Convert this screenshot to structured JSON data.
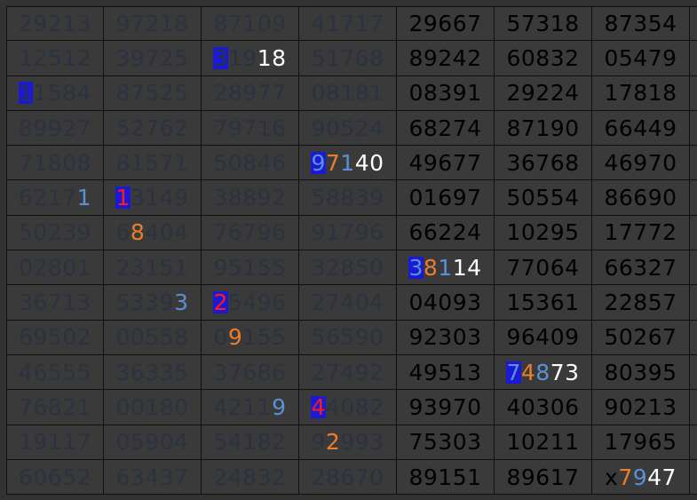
{
  "colors": {
    "background": "#333333",
    "grid_line": "#101010",
    "faded_digit": "#2b3240",
    "bright_digit": "#000000",
    "highlight_box": "#1a1ad6",
    "blue": "#5b8fd6",
    "red": "#ff1a1a",
    "orange": "#ea7d2e",
    "white": "#ffffff"
  },
  "rows": [
    [
      {
        "style": "faded",
        "text": "29213"
      },
      {
        "style": "faded",
        "text": "97218"
      },
      {
        "style": "faded",
        "text": "87109"
      },
      {
        "style": "faded",
        "text": "41717"
      },
      {
        "style": "bright",
        "text": "29667"
      },
      {
        "style": "bright",
        "text": "57318"
      },
      {
        "style": "bright",
        "text": "87354"
      }
    ],
    [
      {
        "style": "faded",
        "text": "12512"
      },
      {
        "style": "faded",
        "text": "39725"
      },
      {
        "style": "mixed",
        "chars": [
          {
            "t": "3",
            "c": "faded",
            "box": true
          },
          {
            "t": "1",
            "c": "faded"
          },
          {
            "t": "9",
            "c": "faded"
          },
          {
            "t": "1",
            "c": "white"
          },
          {
            "t": "8",
            "c": "white"
          }
        ]
      },
      {
        "style": "faded",
        "text": "51768"
      },
      {
        "style": "bright",
        "text": "89242"
      },
      {
        "style": "bright",
        "text": "60832"
      },
      {
        "style": "bright",
        "text": "05479"
      }
    ],
    [
      {
        "style": "mixed",
        "chars": [
          {
            "t": "1",
            "c": "faded",
            "box": true
          },
          {
            "t": "1",
            "c": "faded"
          },
          {
            "t": "5",
            "c": "faded"
          },
          {
            "t": "8",
            "c": "faded"
          },
          {
            "t": "4",
            "c": "faded"
          }
        ]
      },
      {
        "style": "faded",
        "text": "87525"
      },
      {
        "style": "faded",
        "text": "28977"
      },
      {
        "style": "faded",
        "text": "08181"
      },
      {
        "style": "bright",
        "text": "08391"
      },
      {
        "style": "bright",
        "text": "29224"
      },
      {
        "style": "bright",
        "text": "17818"
      }
    ],
    [
      {
        "style": "faded",
        "text": "89927"
      },
      {
        "style": "faded",
        "text": "52762"
      },
      {
        "style": "faded",
        "text": "79716"
      },
      {
        "style": "faded",
        "text": "90524"
      },
      {
        "style": "bright",
        "text": "68274"
      },
      {
        "style": "bright",
        "text": "87190"
      },
      {
        "style": "bright",
        "text": "66449"
      }
    ],
    [
      {
        "style": "faded",
        "text": "71808"
      },
      {
        "style": "faded",
        "text": "81571"
      },
      {
        "style": "faded",
        "text": "50846"
      },
      {
        "style": "mixed",
        "chars": [
          {
            "t": "9",
            "c": "blue",
            "box": true
          },
          {
            "t": "7",
            "c": "orange"
          },
          {
            "t": "1",
            "c": "blue"
          },
          {
            "t": "4",
            "c": "white"
          },
          {
            "t": "0",
            "c": "white"
          }
        ]
      },
      {
        "style": "bright",
        "text": "49677"
      },
      {
        "style": "bright",
        "text": "36768"
      },
      {
        "style": "bright",
        "text": "46970"
      }
    ],
    [
      {
        "style": "mixed",
        "chars": [
          {
            "t": "6",
            "c": "faded"
          },
          {
            "t": "2",
            "c": "faded"
          },
          {
            "t": "1",
            "c": "faded"
          },
          {
            "t": "7",
            "c": "faded"
          },
          {
            "t": "1",
            "c": "blue"
          }
        ]
      },
      {
        "style": "mixed",
        "chars": [
          {
            "t": "1",
            "c": "red",
            "box": true
          },
          {
            "t": "3",
            "c": "faded"
          },
          {
            "t": "1",
            "c": "faded"
          },
          {
            "t": "4",
            "c": "faded"
          },
          {
            "t": "9",
            "c": "faded"
          }
        ]
      },
      {
        "style": "faded",
        "text": "38892"
      },
      {
        "style": "faded",
        "text": "58839"
      },
      {
        "style": "bright",
        "text": "01697"
      },
      {
        "style": "bright",
        "text": "50554"
      },
      {
        "style": "bright",
        "text": "86690"
      }
    ],
    [
      {
        "style": "faded",
        "text": "50239"
      },
      {
        "style": "mixed",
        "chars": [
          {
            "t": "6",
            "c": "faded"
          },
          {
            "t": "8",
            "c": "orange"
          },
          {
            "t": "4",
            "c": "faded"
          },
          {
            "t": "0",
            "c": "faded"
          },
          {
            "t": "4",
            "c": "faded"
          }
        ]
      },
      {
        "style": "faded",
        "text": "76796"
      },
      {
        "style": "faded",
        "text": "91796"
      },
      {
        "style": "bright",
        "text": "66224"
      },
      {
        "style": "bright",
        "text": "10295"
      },
      {
        "style": "bright",
        "text": "17772"
      }
    ],
    [
      {
        "style": "faded",
        "text": "02801"
      },
      {
        "style": "faded",
        "text": "23151"
      },
      {
        "style": "faded",
        "text": "95155"
      },
      {
        "style": "faded",
        "text": "32850"
      },
      {
        "style": "mixed",
        "chars": [
          {
            "t": "3",
            "c": "blue",
            "box": true
          },
          {
            "t": "8",
            "c": "orange"
          },
          {
            "t": "1",
            "c": "blue"
          },
          {
            "t": "1",
            "c": "white"
          },
          {
            "t": "4",
            "c": "white"
          }
        ]
      },
      {
        "style": "bright",
        "text": "77064"
      },
      {
        "style": "bright",
        "text": "66327"
      }
    ],
    [
      {
        "style": "faded",
        "text": "36713"
      },
      {
        "style": "mixed",
        "chars": [
          {
            "t": "5",
            "c": "faded"
          },
          {
            "t": "3",
            "c": "faded"
          },
          {
            "t": "3",
            "c": "faded"
          },
          {
            "t": "9",
            "c": "faded"
          },
          {
            "t": "3",
            "c": "blue"
          }
        ]
      },
      {
        "style": "mixed",
        "chars": [
          {
            "t": "2",
            "c": "red",
            "box": true
          },
          {
            "t": "5",
            "c": "faded"
          },
          {
            "t": "4",
            "c": "faded"
          },
          {
            "t": "9",
            "c": "faded"
          },
          {
            "t": "6",
            "c": "faded"
          }
        ]
      },
      {
        "style": "faded",
        "text": "27404"
      },
      {
        "style": "bright",
        "text": "04093"
      },
      {
        "style": "bright",
        "text": "15361"
      },
      {
        "style": "bright",
        "text": "22857"
      }
    ],
    [
      {
        "style": "faded",
        "text": "69502"
      },
      {
        "style": "faded",
        "text": "00558"
      },
      {
        "style": "mixed",
        "chars": [
          {
            "t": "0",
            "c": "faded"
          },
          {
            "t": "9",
            "c": "orange"
          },
          {
            "t": "1",
            "c": "faded"
          },
          {
            "t": "5",
            "c": "faded"
          },
          {
            "t": "5",
            "c": "faded"
          }
        ]
      },
      {
        "style": "faded",
        "text": "56590"
      },
      {
        "style": "bright",
        "text": "92303"
      },
      {
        "style": "bright",
        "text": "96409"
      },
      {
        "style": "bright",
        "text": "50267"
      }
    ],
    [
      {
        "style": "faded",
        "text": "46555"
      },
      {
        "style": "faded",
        "text": "36335"
      },
      {
        "style": "faded",
        "text": "37686"
      },
      {
        "style": "faded",
        "text": "27492"
      },
      {
        "style": "bright",
        "text": "49513"
      },
      {
        "style": "mixed",
        "chars": [
          {
            "t": "7",
            "c": "blue",
            "box": true
          },
          {
            "t": "4",
            "c": "orange"
          },
          {
            "t": "8",
            "c": "blue"
          },
          {
            "t": "7",
            "c": "white"
          },
          {
            "t": "3",
            "c": "white"
          }
        ]
      },
      {
        "style": "bright",
        "text": "80395"
      }
    ],
    [
      {
        "style": "faded",
        "text": "76821"
      },
      {
        "style": "faded",
        "text": "00180"
      },
      {
        "style": "mixed",
        "chars": [
          {
            "t": "4",
            "c": "faded"
          },
          {
            "t": "2",
            "c": "faded"
          },
          {
            "t": "1",
            "c": "faded"
          },
          {
            "t": "1",
            "c": "faded"
          },
          {
            "t": "9",
            "c": "blue"
          }
        ]
      },
      {
        "style": "mixed",
        "chars": [
          {
            "t": "4",
            "c": "red",
            "box": true
          },
          {
            "t": "4",
            "c": "faded"
          },
          {
            "t": "0",
            "c": "faded"
          },
          {
            "t": "8",
            "c": "faded"
          },
          {
            "t": "2",
            "c": "faded"
          }
        ]
      },
      {
        "style": "bright",
        "text": "93970"
      },
      {
        "style": "bright",
        "text": "40306"
      },
      {
        "style": "bright",
        "text": "90213"
      }
    ],
    [
      {
        "style": "faded",
        "text": "19117"
      },
      {
        "style": "faded",
        "text": "05904"
      },
      {
        "style": "faded",
        "text": "54182"
      },
      {
        "style": "mixed",
        "chars": [
          {
            "t": "9",
            "c": "faded"
          },
          {
            "t": "2",
            "c": "orange"
          },
          {
            "t": "9",
            "c": "faded"
          },
          {
            "t": "9",
            "c": "faded"
          },
          {
            "t": "3",
            "c": "faded"
          }
        ]
      },
      {
        "style": "bright",
        "text": "75303"
      },
      {
        "style": "bright",
        "text": "10211"
      },
      {
        "style": "bright",
        "text": "17965"
      }
    ],
    [
      {
        "style": "faded",
        "text": "60652"
      },
      {
        "style": "faded",
        "text": "63437"
      },
      {
        "style": "faded",
        "text": "24832"
      },
      {
        "style": "faded",
        "text": "28670"
      },
      {
        "style": "bright",
        "text": "89151"
      },
      {
        "style": "bright",
        "text": "89617"
      },
      {
        "style": "mixed",
        "chars": [
          {
            "t": "x",
            "c": "black"
          },
          {
            "t": "7",
            "c": "orange"
          },
          {
            "t": "9",
            "c": "blue"
          },
          {
            "t": "4",
            "c": "white"
          },
          {
            "t": "7",
            "c": "white"
          }
        ]
      }
    ]
  ]
}
